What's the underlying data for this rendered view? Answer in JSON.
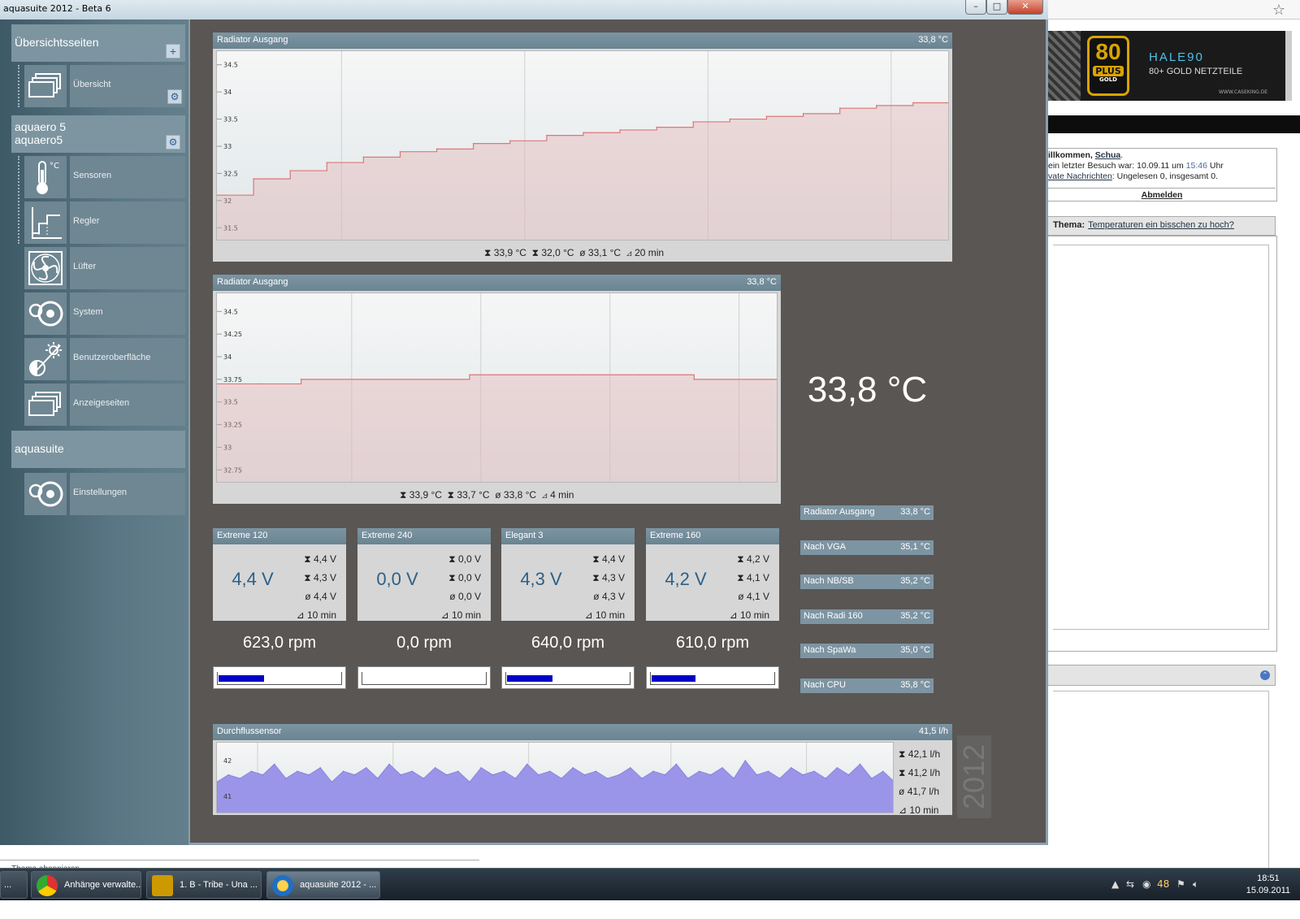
{
  "window": {
    "title": "aquasuite 2012 - Beta 6"
  },
  "sidebar": {
    "section1": {
      "title": "Übersichtsseiten",
      "items": [
        {
          "label": "Übersicht",
          "icon": "pages-icon"
        }
      ]
    },
    "section2": {
      "title_line1": "aquaero 5",
      "title_line2": "aquaero5",
      "items": [
        {
          "label": "Sensoren",
          "icon": "thermometer-icon"
        },
        {
          "label": "Regler",
          "icon": "controller-icon"
        },
        {
          "label": "Lüfter",
          "icon": "fan-icon"
        },
        {
          "label": "System",
          "icon": "system-icon"
        },
        {
          "label": "Benutzeroberfläche",
          "icon": "brightness-icon"
        },
        {
          "label": "Anzeigeseiten",
          "icon": "pages-icon"
        }
      ]
    },
    "section3": {
      "title": "aquasuite",
      "items": [
        {
          "label": "Einstellungen",
          "icon": "settings-icon"
        }
      ]
    }
  },
  "chart1": {
    "title": "Radiator Ausgang",
    "value": "33,8 °C",
    "stats": {
      "max": "33,9 °C",
      "min": "32,0 °C",
      "avg": "33,1 °C",
      "span": "20 min"
    },
    "yticks": [
      "34.5",
      "34",
      "33.5",
      "33",
      "32.5",
      "32",
      "31.5"
    ]
  },
  "chart2": {
    "title": "Radiator Ausgang",
    "value": "33,8 °C",
    "stats": {
      "max": "33,9 °C",
      "min": "33,7 °C",
      "avg": "33,8 °C",
      "span": "4 min"
    },
    "yticks": [
      "34.5",
      "34.25",
      "34",
      "33.75",
      "33.5",
      "33.25",
      "33",
      "32.75"
    ]
  },
  "big_temp": "33,8 °C",
  "fans": [
    {
      "name": "Extreme 120",
      "volt": "4,4 V",
      "max": "4,4 V",
      "min": "4,3 V",
      "avg": "4,4 V",
      "span": "10 min",
      "rpm": "623,0 rpm",
      "level": 0.37
    },
    {
      "name": "Extreme 240",
      "volt": "0,0 V",
      "max": "0,0 V",
      "min": "0,0 V",
      "avg": "0,0 V",
      "span": "10 min",
      "rpm": "0,0 rpm",
      "level": 0.0
    },
    {
      "name": "Elegant 3",
      "volt": "4,3 V",
      "max": "4,4 V",
      "min": "4,3 V",
      "avg": "4,3 V",
      "span": "10 min",
      "rpm": "640,0 rpm",
      "level": 0.37
    },
    {
      "name": "Extreme 160",
      "volt": "4,2 V",
      "max": "4,2 V",
      "min": "4,1 V",
      "avg": "4,1 V",
      "span": "10 min",
      "rpm": "610,0 rpm",
      "level": 0.36
    }
  ],
  "temps": [
    {
      "label": "Radiator Ausgang",
      "value": "33,8 °C"
    },
    {
      "label": "Nach VGA",
      "value": "35,1 °C"
    },
    {
      "label": "Nach NB/SB",
      "value": "35,2 °C"
    },
    {
      "label": "Nach Radi 160",
      "value": "35,2 °C"
    },
    {
      "label": "Nach SpaWa",
      "value": "35,0 °C"
    },
    {
      "label": "Nach CPU",
      "value": "35,8 °C"
    }
  ],
  "flow": {
    "title": "Durchflussensor",
    "value": "41,5 l/h",
    "stats": {
      "max": "42,1 l/h",
      "min": "41,2 l/h",
      "avg": "41,7 l/h",
      "span": "10 min"
    },
    "yticks": [
      "42",
      "41"
    ]
  },
  "watermark": "2012",
  "browser": {
    "banner_title": "HALE90",
    "banner_sub": "80+ GOLD NETZTEILE",
    "banner_url": "WWW.CASEKING.DE",
    "badge_num": "80",
    "badge_plus": "PLUS",
    "badge_gold": "GOLD",
    "welcome_prefix": "illkommen, ",
    "welcome_user": "Schua",
    "welcome_suffix": ".",
    "last_visit_prefix": "ein letzter Besuch war: 10.09.11 um ",
    "last_visit_time": "15:46",
    "last_visit_suffix": " Uhr",
    "pm_link": "vate Nachrichten",
    "pm_text": ": Ungelesen 0, insgesamt 0.",
    "logout": "Abmelden",
    "thema_label": "Thema:",
    "thema_link": "Temperaturen ein bisschen zu hoch?",
    "subscribe": "Thema abonnieren"
  },
  "taskbar": {
    "tasks": [
      {
        "label": "..."
      },
      {
        "label": "Anhänge verwalte..."
      },
      {
        "label": "1. B - Tribe - Una ..."
      },
      {
        "label": "aquasuite 2012 - ..."
      }
    ],
    "tray_num": "48",
    "time": "18:51",
    "date": "15.09.2011"
  },
  "chart_data": [
    {
      "type": "line",
      "title": "Radiator Ausgang",
      "ylim": [
        31.25,
        34.75
      ],
      "x": [
        0,
        1,
        2,
        3,
        4,
        5,
        6,
        7,
        8,
        9,
        10,
        11,
        12,
        13,
        14,
        15,
        16,
        17,
        18,
        19,
        20
      ],
      "values": [
        32.1,
        32.4,
        32.55,
        32.7,
        32.8,
        32.9,
        32.95,
        33.05,
        33.1,
        33.2,
        33.25,
        33.3,
        33.35,
        33.45,
        33.5,
        33.55,
        33.6,
        33.7,
        33.75,
        33.8,
        33.75
      ]
    },
    {
      "type": "line",
      "title": "Radiator Ausgang",
      "ylim": [
        32.6,
        34.7
      ],
      "x": [
        0,
        0.3,
        0.6,
        1,
        1.4,
        1.8,
        2.2,
        2.6,
        3,
        3.4,
        3.8,
        4
      ],
      "values": [
        33.7,
        33.7,
        33.75,
        33.75,
        33.75,
        33.8,
        33.8,
        33.8,
        33.8,
        33.75,
        33.75,
        33.75
      ]
    },
    {
      "type": "area",
      "title": "Durchflussensor",
      "ylim": [
        40.5,
        42.5
      ],
      "values": [
        41.4,
        41.6,
        41.5,
        41.7,
        41.6,
        41.9,
        41.5,
        41.7,
        41.6,
        41.8,
        41.4,
        41.7,
        41.6,
        41.8,
        41.5,
        41.9,
        41.6,
        41.7,
        41.5,
        41.8,
        41.6,
        41.7,
        41.4,
        41.8,
        41.6,
        41.7,
        41.5,
        41.9,
        41.6,
        41.7,
        41.5,
        41.8,
        41.6,
        41.7,
        41.5,
        41.6,
        41.8,
        41.5,
        41.7,
        41.6,
        41.9,
        41.5,
        41.7,
        41.6,
        41.8,
        41.5,
        42.0,
        41.6,
        41.7,
        41.5,
        41.8,
        41.6,
        41.7,
        41.5,
        41.8,
        41.6,
        41.9,
        41.5,
        41.7,
        41.4
      ]
    }
  ]
}
